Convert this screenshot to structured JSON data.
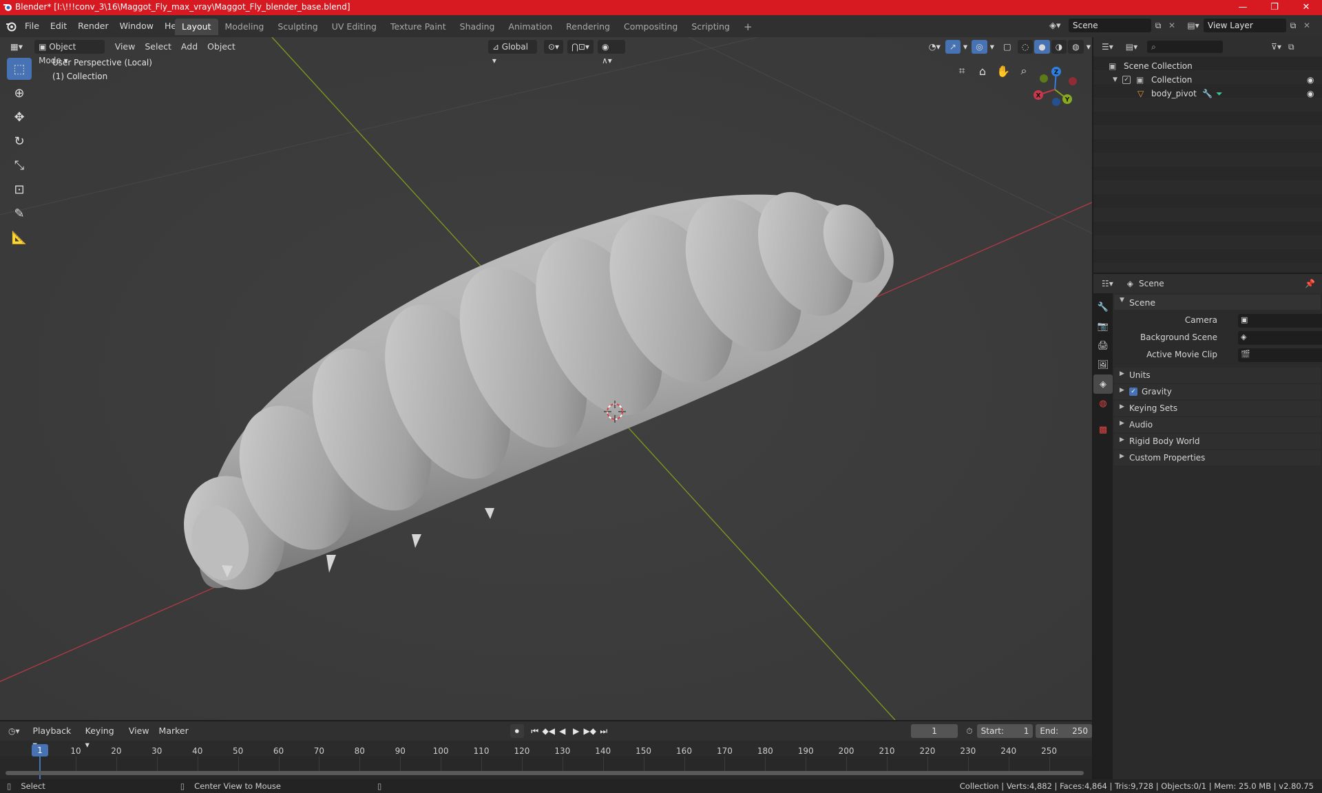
{
  "titlebar": {
    "title": "Blender* [I:\\!!!conv_3\\16\\Maggot_Fly_max_vray\\Maggot_Fly_blender_base.blend]",
    "minimize": "—",
    "maximize": "❐",
    "close": "✕"
  },
  "menubar": {
    "menus": [
      "File",
      "Edit",
      "Render",
      "Window",
      "Help"
    ],
    "workspaces": [
      "Layout",
      "Modeling",
      "Sculpting",
      "UV Editing",
      "Texture Paint",
      "Shading",
      "Animation",
      "Rendering",
      "Compositing",
      "Scripting"
    ],
    "active_workspace": "Layout",
    "add_workspace": "+",
    "scene_name": "Scene",
    "view_layer": "View Layer"
  },
  "viewport": {
    "mode": "Object Mode",
    "menus": [
      "View",
      "Select",
      "Add",
      "Object"
    ],
    "orientation": "Global",
    "perspective": "User Perspective (Local)",
    "collection_info": "(1) Collection",
    "gizmo": {
      "x": "X",
      "y": "Y",
      "z": "Z"
    }
  },
  "outliner": {
    "scene_collection": "Scene Collection",
    "collection": "Collection",
    "object": "body_pivot"
  },
  "properties": {
    "context": "Scene",
    "panel_title": "Scene",
    "camera_label": "Camera",
    "background_scene_label": "Background Scene",
    "active_movie_clip_label": "Active Movie Clip",
    "sections": [
      {
        "label": "Units",
        "checkbox": false
      },
      {
        "label": "Gravity",
        "checkbox": true
      },
      {
        "label": "Keying Sets",
        "checkbox": false
      },
      {
        "label": "Audio",
        "checkbox": false
      },
      {
        "label": "Rigid Body World",
        "checkbox": false
      },
      {
        "label": "Custom Properties",
        "checkbox": false
      }
    ]
  },
  "timeline": {
    "menus": [
      "Playback",
      "Keying",
      "View",
      "Marker"
    ],
    "current_frame": "1",
    "start_label": "Start:",
    "start": "1",
    "end_label": "End:",
    "end": "250",
    "ticks": [
      "1",
      "10",
      "20",
      "30",
      "40",
      "50",
      "60",
      "70",
      "80",
      "90",
      "100",
      "110",
      "120",
      "130",
      "140",
      "150",
      "160",
      "170",
      "180",
      "190",
      "200",
      "210",
      "220",
      "230",
      "240",
      "250"
    ]
  },
  "statusbar": {
    "select": "Select",
    "center_view": "Center View to Mouse",
    "stats": "Collection | Verts:4,882 | Faces:4,864 | Tris:9,728 | Objects:0/1 | Mem: 25.0 MB | v2.80.75"
  },
  "colors": {
    "accent": "#4772b3",
    "title_bar": "#d71a22",
    "x_axis": "#c7384a",
    "y_axis": "#8aaa1e",
    "z_axis": "#2f7fe0"
  }
}
